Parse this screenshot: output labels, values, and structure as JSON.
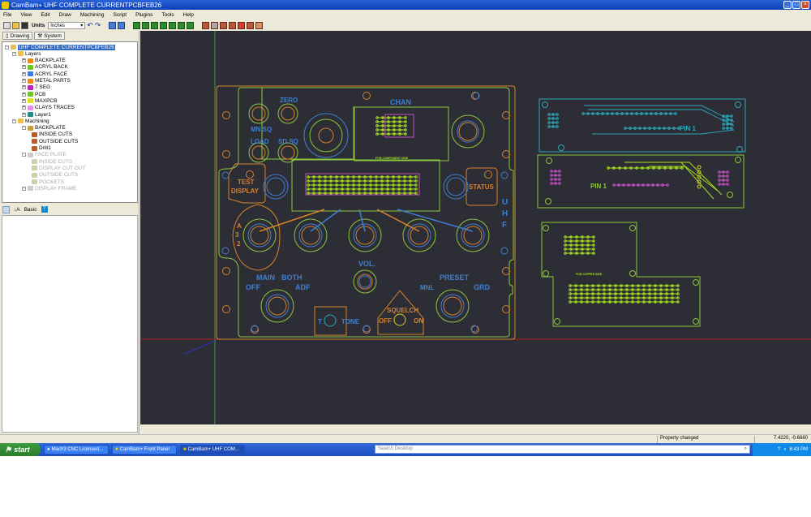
{
  "window": {
    "app": "CamBam+",
    "title": "CamBam+  UHF COMPLETE CURRENTPCBFEB26"
  },
  "menu": [
    "File",
    "View",
    "Edit",
    "Draw",
    "Machining",
    "Script",
    "Plugins",
    "Tools",
    "Help"
  ],
  "toolbar": {
    "units_label": "Units",
    "units_value": "Inches"
  },
  "left_tabs": [
    "Drawing",
    "System"
  ],
  "tree": {
    "root": "UHF COMPLETE CURRENTPCBFEB26",
    "layers_label": "Layers",
    "layers": [
      {
        "name": "BACKPLATE",
        "color": "#e88a1a"
      },
      {
        "name": "ACRYL BACK",
        "color": "#6cc820"
      },
      {
        "name": "ACRYL FACE",
        "color": "#3a7ad8"
      },
      {
        "name": "METAL PARTS",
        "color": "#e88a1a"
      },
      {
        "name": "7 SEG",
        "color": "#c020c0"
      },
      {
        "name": "PCB",
        "color": "#6cc820"
      },
      {
        "name": "MAXPCB",
        "color": "#e0e020"
      },
      {
        "name": "CLAYS TRACES",
        "color": "#e090e0"
      },
      {
        "name": "Layer1",
        "color": "#2a8a8a"
      }
    ],
    "machining_label": "Machining",
    "parts": [
      {
        "name": "BACKPLATE",
        "ops": [
          "INSIDE CUTS",
          "OUTSIDE CUTS",
          "Drill1"
        ],
        "enabled": true
      },
      {
        "name": "FACE PLATE",
        "ops": [
          "INSIDE CUTS",
          "DISPLAY CUT OUT",
          "OUTSIDE CUTS",
          "POCKETS"
        ],
        "enabled": false
      },
      {
        "name": "DISPLAY FRAME",
        "ops": [],
        "enabled": false
      }
    ]
  },
  "properties": {
    "mode_label": "Basic"
  },
  "drawing": {
    "labels": {
      "zero": "ZERO",
      "mn_sq": "MN SQ",
      "load": "LOAD",
      "sd_sq": "SD SQ",
      "chan": "CHAN",
      "test": "TEST",
      "display": "DISPLAY",
      "status": "STATUS",
      "u": "U",
      "h": "H",
      "f": "F",
      "a": "A",
      "three": "3",
      "two": "2",
      "vol": "VOL.",
      "main": "MAIN",
      "both": "BOTH",
      "off": "OFF",
      "adf": "ADF",
      "preset": "PRESET",
      "mnl": "MNL",
      "grd": "GRD",
      "t": "T",
      "tone": "TONE",
      "squelch": "SQUELCH",
      "sq_off": "OFF",
      "sq_on": "ON",
      "pcb_component": "PCB COMPONENT SIDE",
      "pcb_copper": "PCB COPPER SIDE",
      "pin1_a": "PIN 1",
      "pin1_b": "PIN 1"
    },
    "colors": {
      "background": "#2d2d36",
      "orange": "#d9822b",
      "green": "#8cc63f",
      "blue": "#3f7fd0",
      "cyan": "#2aa6b8",
      "magenta": "#c050c0",
      "yellow": "#d8d020",
      "pcb": "#a8e020"
    }
  },
  "status": {
    "message": "Property changed",
    "coords": "7.4220, -0.6660"
  },
  "taskbar": {
    "start": "start",
    "tasks": [
      "Mach3 CNC  Licensed...",
      "CamBam+  Front Panel",
      "CamBam+  UHF COM..."
    ],
    "search_placeholder": "Search Desktop",
    "clock": "6:43 PM"
  }
}
